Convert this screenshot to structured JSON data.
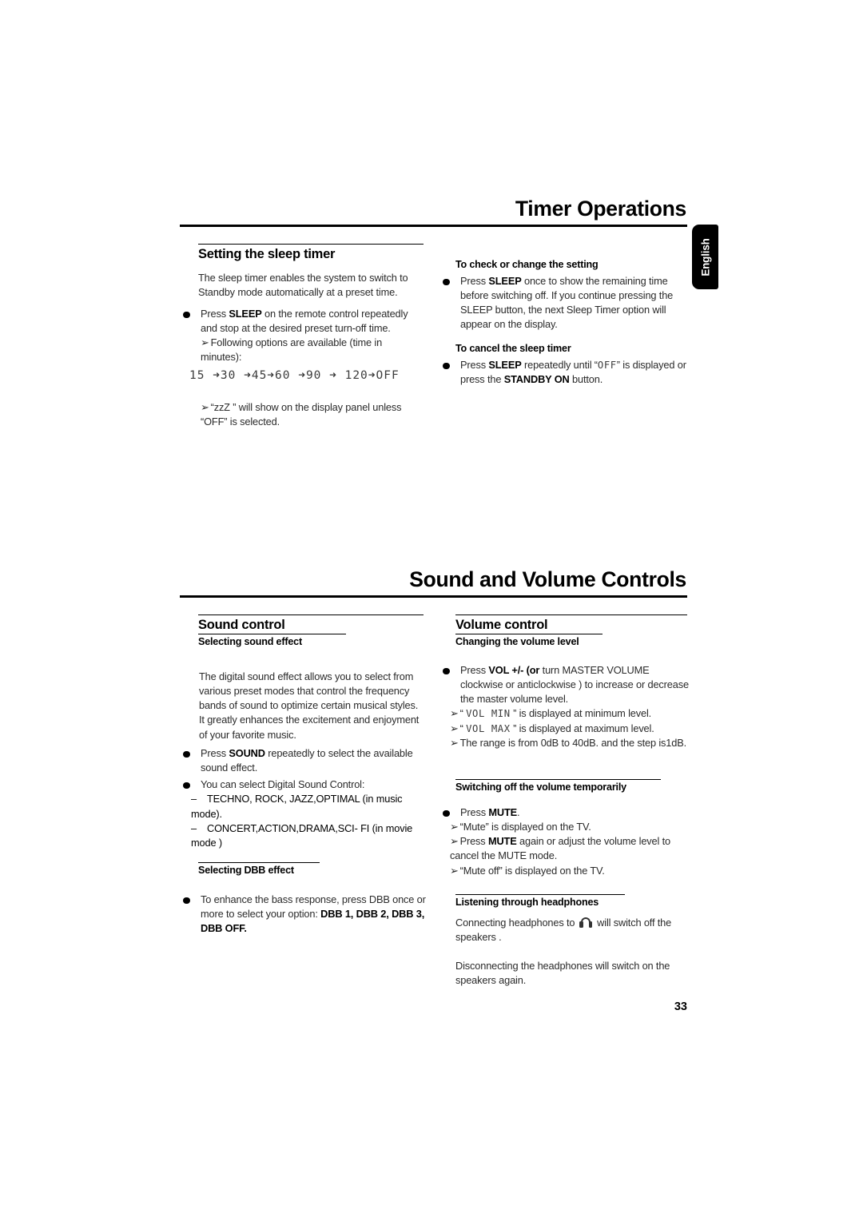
{
  "page": {
    "number": "33",
    "language_tab": "English"
  },
  "chapters": [
    {
      "title": "Timer Operations"
    },
    {
      "title": "Sound and Volume Controls"
    }
  ],
  "timer": {
    "left": {
      "heading": "Setting the sleep timer",
      "intro": "The sleep timer enables the system to switch to Standby mode automatically at a preset time.",
      "bullet1_pre": "Press ",
      "bullet1_bold": "SLEEP",
      "bullet1_post": " on the remote control repeatedly and stop at the desired preset turn-off time.",
      "arrow1": "Following options are available (time in minutes):",
      "sequence": "15 ➜30 ➜45➜60 ➜90 ➜ 120➜OFF",
      "sequence_values": [
        "15",
        "30",
        "45",
        "60",
        "90",
        "120",
        "OFF"
      ],
      "arrow2": "“zzZ ” will show on the display panel unless “OFF” is selected."
    },
    "right": {
      "head1": "To check or change the setting",
      "b1_pre": "Press ",
      "b1_bold": "SLEEP",
      "b1_post": " once to show the remaining time before switching off.  If you continue pressing the SLEEP button, the next Sleep Timer option will appear on the display.",
      "head2": "To cancel the sleep timer",
      "b2_pre": "Press ",
      "b2_bold": "SLEEP",
      "b2_mid": " repeatedly until “",
      "b2_lcd": "OFF",
      "b2_mid2": "” is displayed or press the ",
      "b2_bold2": "STANDBY ON",
      "b2_post": "  button."
    }
  },
  "sound": {
    "left": {
      "heading": "Sound control",
      "subhead1": "Selecting sound effect",
      "intro": "The digital sound effect allows you to select from various preset modes that control the frequency bands of sound to optimize certain musical styles. It greatly enhances the excitement and enjoyment of your favorite music.",
      "b1_pre": "Press ",
      "b1_bold": "SOUND",
      "b1_post": " repeatedly to select the available sound effect.",
      "b2": "You can select Digital Sound Control:",
      "dash1_dash": "–",
      "dash1": "TECHNO, ROCK, JAZZ,OPTIMAL (in music mode).",
      "dash2_dash": "–",
      "dash2": "CONCERT,ACTION,DRAMA,SCI- FI (in movie mode )",
      "subhead2": "Selecting DBB effect",
      "b3_pre": "To enhance the bass response, press DBB once or more to select your option: ",
      "b3_bold": "DBB 1, DBB 2, DBB 3, DBB OFF."
    },
    "right": {
      "heading": "Volume control",
      "subhead1": "Changing the volume level",
      "b1_pre": "Press ",
      "b1_bold": "VOL +/-",
      "b1_bold2": "  (or",
      "b1_post": " turn MASTER  VOLUME clockwise or anticlockwise ) to increase or decrease the master volume level.",
      "a1_pre": "“ ",
      "a1_lcd": "VOL MIN",
      "a1_post": " ” is displayed at minimum level.",
      "a2_pre": "“ ",
      "a2_lcd": "VOL MAX",
      "a2_post": " ” is displayed at maximum level.",
      "a3": "The range is from 0dB to 40dB. and the step is1dB.",
      "subhead2": "Switching off the volume temporarily",
      "b2_pre": "Press ",
      "b2_bold": "MUTE",
      "b2_post": ".",
      "m1": "“Mute” is displayed on the  TV.",
      "m2_pre": "Press ",
      "m2_bold": "MUTE",
      "m2_post": " again or adjust the volume level to cancel the MUTE mode.",
      "m3": "“Mute off” is displayed on the  TV.",
      "subhead3": "Listening through headphones",
      "hp_pre": "Connecting headphones to ",
      "hp_post": " will switch off the speakers .",
      "hp2": "Disconnecting the headphones will switch on the speakers again."
    }
  }
}
